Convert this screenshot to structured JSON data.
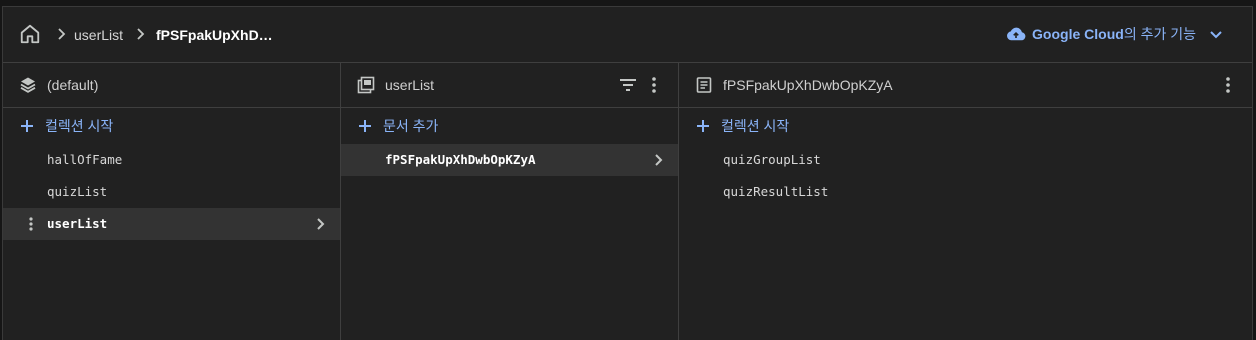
{
  "breadcrumb": {
    "items": [
      "userList",
      "fPSFpakUpXhD…"
    ]
  },
  "google_cloud": {
    "brand": "Google Cloud",
    "suffix": "의 추가 기능"
  },
  "columns": [
    {
      "title": "(default)",
      "icon": "stack-icon",
      "add_label": "컬렉션 시작",
      "items": [
        {
          "label": "hallOfFame",
          "selected": false
        },
        {
          "label": "quizList",
          "selected": false
        },
        {
          "label": "userList",
          "selected": true
        }
      ]
    },
    {
      "title": "userList",
      "icon": "collection-icon",
      "add_label": "문서 추가",
      "items": [
        {
          "label": "fPSFpakUpXhDwbOpKZyA",
          "selected": true
        }
      ]
    },
    {
      "title": "fPSFpakUpXhDwbOpKZyA",
      "icon": "document-icon",
      "add_label": "컬렉션 시작",
      "items": [
        {
          "label": "quizGroupList",
          "selected": false
        },
        {
          "label": "quizResultList",
          "selected": false
        }
      ]
    }
  ],
  "colors": {
    "accent": "#8ab4f8",
    "background": "#212121",
    "selected_row": "#333333"
  }
}
